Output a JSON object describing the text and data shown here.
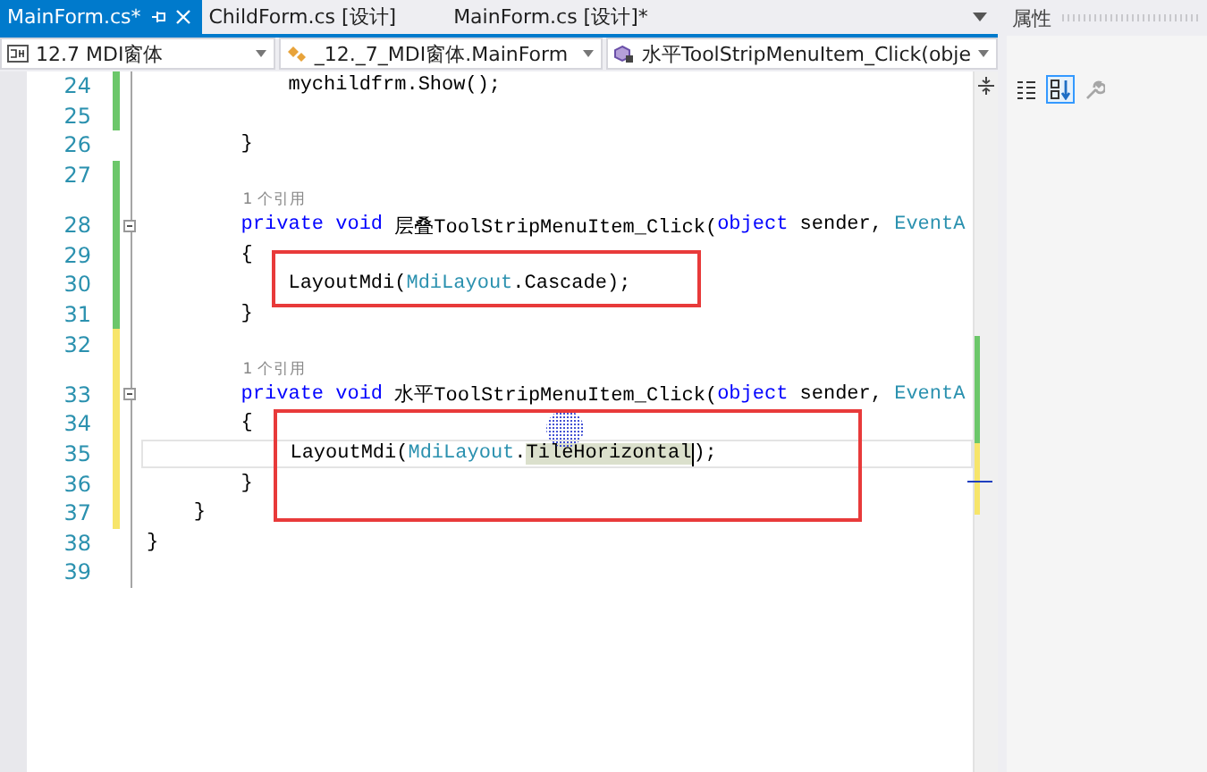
{
  "tabs": [
    {
      "label": "MainForm.cs*",
      "selected": true,
      "pinned": true,
      "closable": true
    },
    {
      "label": "ChildForm.cs [设计]",
      "selected": false,
      "pinned": false,
      "closable": false
    },
    {
      "label": "MainForm.cs [设计]*",
      "selected": false,
      "pinned": false,
      "closable": false
    }
  ],
  "nav": [
    {
      "kind": "project",
      "text": "12.7 MDI窗体"
    },
    {
      "kind": "class",
      "text": "_12._7_MDI窗体.MainForm"
    },
    {
      "kind": "method",
      "text": "水平ToolStripMenuItem_Click(obje"
    }
  ],
  "editor": {
    "lines": [
      {
        "kind": "code",
        "number": "24",
        "color": "#6cc76a",
        "fold": false,
        "current": false,
        "tokens": [
          {
            "kind": "plain",
            "text": "            mychildfrm.Show();"
          }
        ]
      },
      {
        "kind": "code",
        "number": "25",
        "color": "#6cc76a",
        "fold": false,
        "current": false
      },
      {
        "kind": "code",
        "number": "26",
        "fold": false,
        "current": false,
        "tokens": [
          {
            "kind": "plain",
            "text": "        }"
          }
        ]
      },
      {
        "kind": "code",
        "number": "27",
        "color": "#6cc76a",
        "fold": false,
        "current": false
      },
      {
        "kind": "ref",
        "color": "#6cc76a",
        "text": "1 个引用"
      },
      {
        "kind": "code",
        "number": "28",
        "color": "#6cc76a",
        "fold": true,
        "current": false,
        "tokens": [
          {
            "kind": "keyword",
            "text": "        private void"
          },
          {
            "kind": "plain",
            "text": " 层叠ToolStripMenuItem_Click("
          },
          {
            "kind": "keyword",
            "text": "object"
          },
          {
            "kind": "plain",
            "text": " sender, "
          },
          {
            "kind": "type",
            "text": "EventA"
          }
        ]
      },
      {
        "kind": "code",
        "number": "29",
        "color": "#6cc76a",
        "fold": false,
        "current": false,
        "tokens": [
          {
            "kind": "plain",
            "text": "        {"
          }
        ]
      },
      {
        "kind": "code",
        "number": "30",
        "color": "#6cc76a",
        "fold": false,
        "current": false,
        "tokens": [
          {
            "kind": "plain",
            "text": "            LayoutMdi("
          },
          {
            "kind": "type",
            "text": "MdiLayout"
          },
          {
            "kind": "plain",
            "text": ".Cascade);"
          }
        ]
      },
      {
        "kind": "code",
        "number": "31",
        "color": "#6cc76a",
        "fold": false,
        "current": false,
        "tokens": [
          {
            "kind": "plain",
            "text": "        }"
          }
        ]
      },
      {
        "kind": "code",
        "number": "32",
        "color": "#f7e56a",
        "fold": false,
        "current": false
      },
      {
        "kind": "ref",
        "color": "#f7e56a",
        "text": "1 个引用"
      },
      {
        "kind": "code",
        "number": "33",
        "color": "#f7e56a",
        "fold": true,
        "current": false,
        "tokens": [
          {
            "kind": "keyword",
            "text": "        private void"
          },
          {
            "kind": "plain",
            "text": " 水平ToolStripMenuItem_Click("
          },
          {
            "kind": "keyword",
            "text": "object"
          },
          {
            "kind": "plain",
            "text": " sender, "
          },
          {
            "kind": "type",
            "text": "EventA"
          }
        ]
      },
      {
        "kind": "code",
        "number": "34",
        "color": "#f7e56a",
        "fold": false,
        "current": false,
        "tokens": [
          {
            "kind": "plain",
            "text": "        {"
          }
        ]
      },
      {
        "kind": "code",
        "number": "35",
        "color": "#f7e56a",
        "fold": false,
        "current": true,
        "tokens": [
          {
            "kind": "plain",
            "text": "            LayoutMdi("
          },
          {
            "kind": "type",
            "text": "MdiLayout"
          },
          {
            "kind": "plain",
            "text": "."
          },
          {
            "kind": "plain",
            "text": "TileHorizontal",
            "highlighted": true,
            "caret": true
          },
          {
            "kind": "plain",
            "text": ");"
          }
        ]
      },
      {
        "kind": "code",
        "number": "36",
        "color": "#f7e56a",
        "fold": false,
        "current": false,
        "tokens": [
          {
            "kind": "plain",
            "text": "        }"
          }
        ]
      },
      {
        "kind": "code",
        "number": "37",
        "color": "#f7e56a",
        "fold": false,
        "current": false,
        "tokens": [
          {
            "kind": "plain",
            "text": "    }"
          }
        ]
      },
      {
        "kind": "code",
        "number": "38",
        "fold": false,
        "current": false,
        "tokens": [
          {
            "kind": "plain",
            "text": "}"
          }
        ]
      },
      {
        "kind": "code",
        "number": "39",
        "fold": false,
        "current": false
      }
    ],
    "annotations": [
      {
        "kind": "rectangle"
      },
      {
        "kind": "rectangle"
      }
    ]
  },
  "properties": {
    "title": "属性",
    "tools": [
      {
        "kind": "categorized",
        "selected": false,
        "disabled": false
      },
      {
        "kind": "alphabetical",
        "selected": true,
        "disabled": false
      },
      {
        "kind": "wrench",
        "selected": false,
        "disabled": true
      }
    ]
  }
}
